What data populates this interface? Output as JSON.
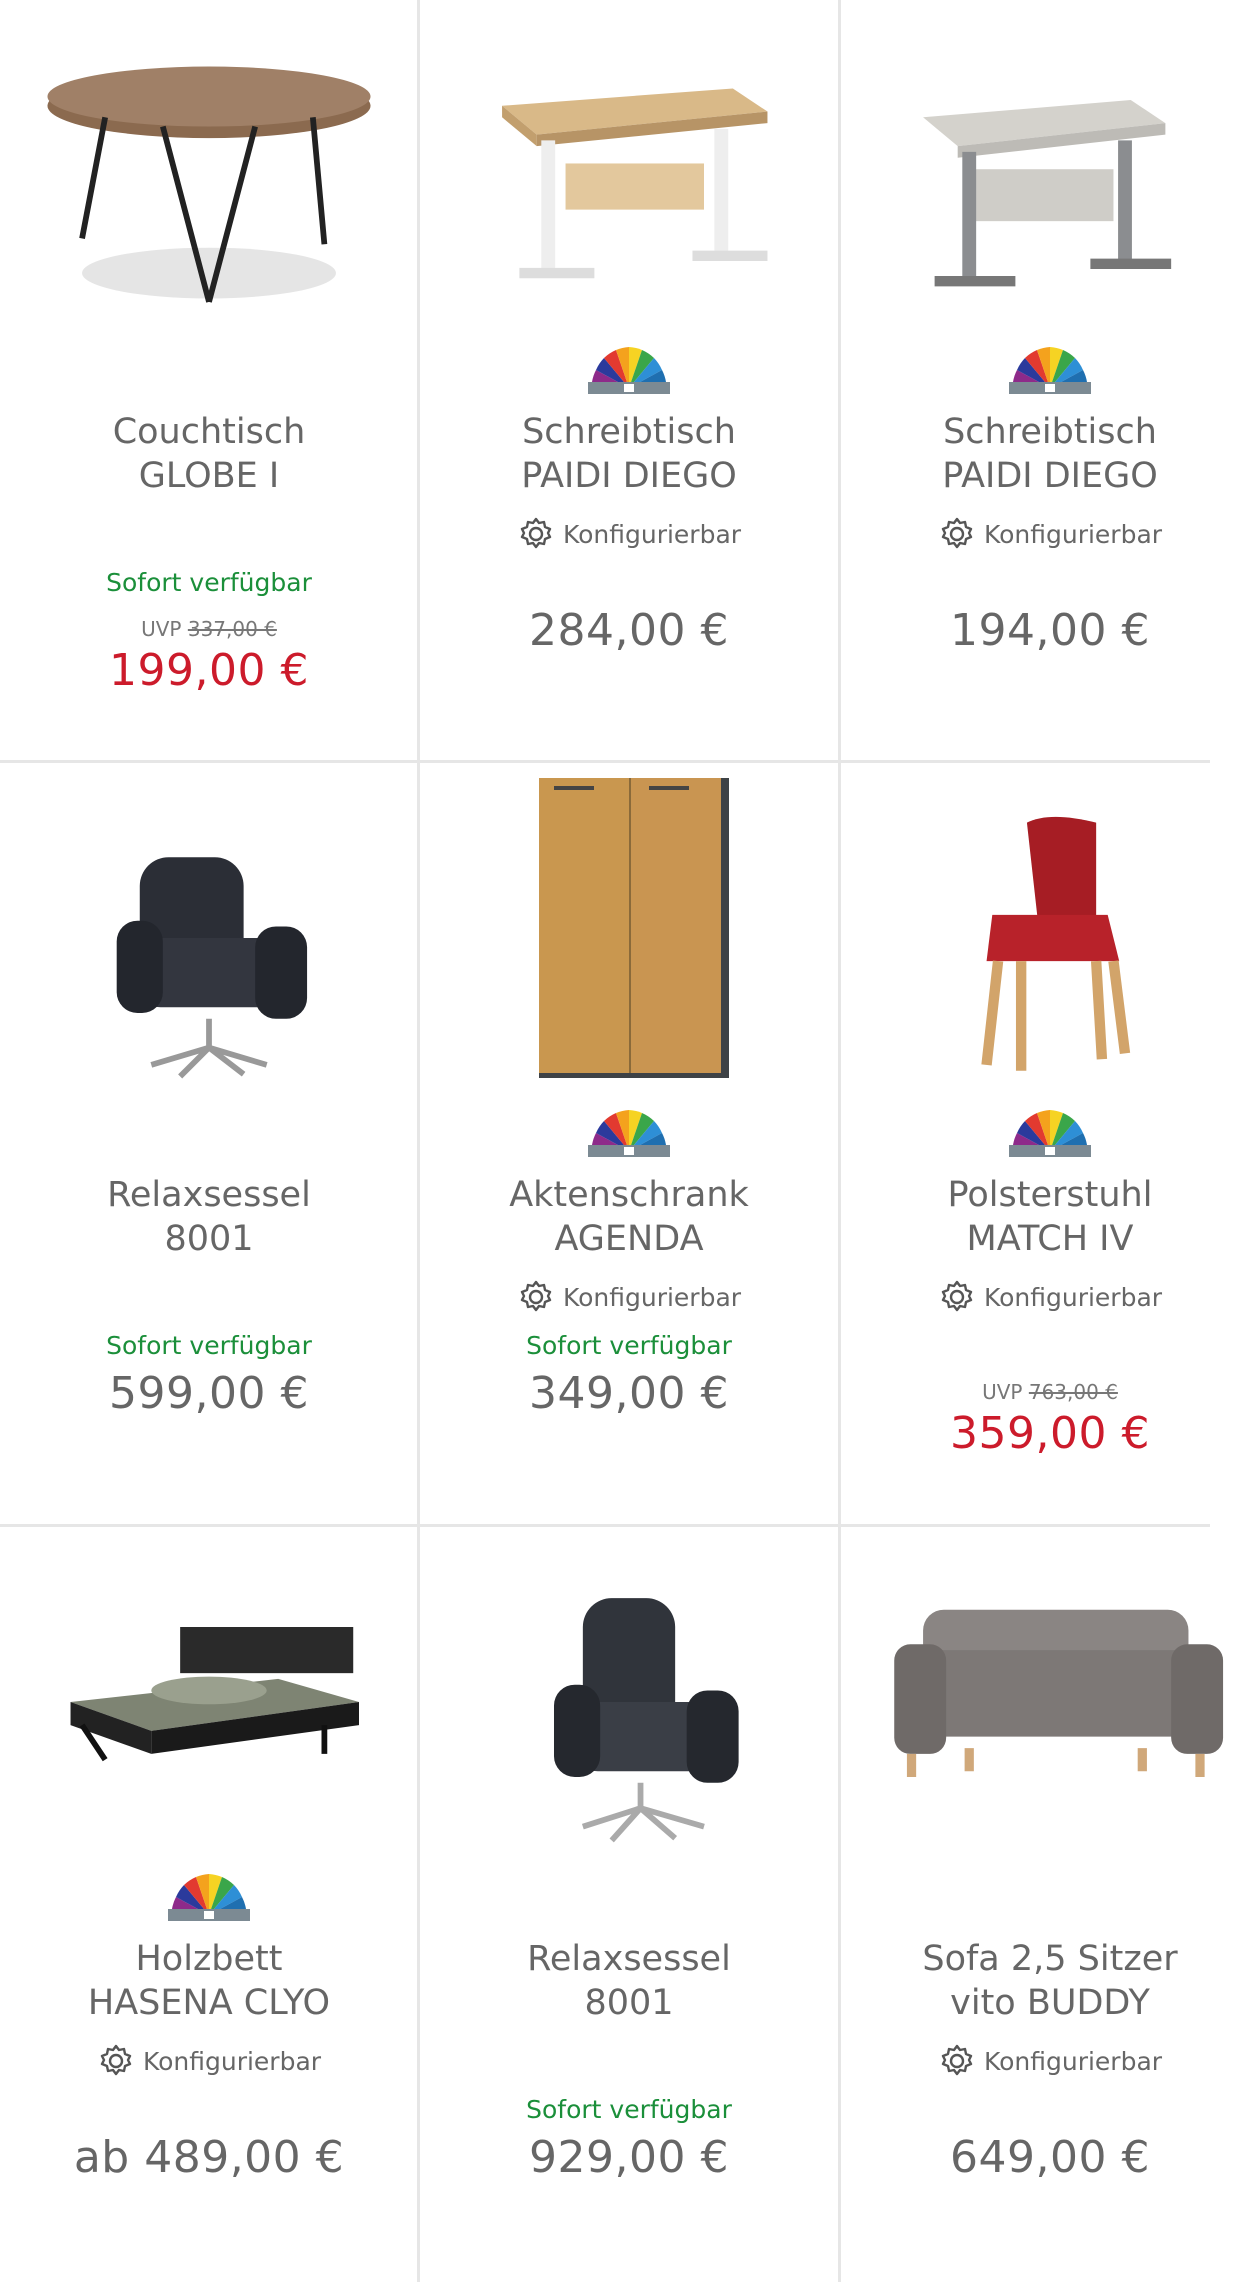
{
  "products": [
    {
      "title_line1": "Couchtisch",
      "title_line2": "GLOBE I",
      "configurable": false,
      "config_label": "",
      "availability": "Sofort verfügbar",
      "uvp_label": "UVP",
      "uvp_price": "337,00 €",
      "price": "199,00 €",
      "sale": true,
      "colors_badge": false,
      "image": "round-coffee-table"
    },
    {
      "title_line1": "Schreibtisch",
      "title_line2": "PAIDI DIEGO",
      "configurable": true,
      "config_label": "Konfigurierbar",
      "availability": "",
      "uvp_label": "",
      "uvp_price": "",
      "price": "284,00 €",
      "sale": false,
      "colors_badge": true,
      "image": "oak-desk"
    },
    {
      "title_line1": "Schreibtisch",
      "title_line2": "PAIDI DIEGO",
      "configurable": true,
      "config_label": "Konfigurierbar",
      "availability": "",
      "uvp_label": "",
      "uvp_price": "",
      "price": "194,00 €",
      "sale": false,
      "colors_badge": true,
      "image": "grey-desk"
    },
    {
      "title_line1": "Relaxsessel",
      "title_line2": "8001",
      "configurable": false,
      "config_label": "",
      "availability": "Sofort verfügbar",
      "uvp_label": "",
      "uvp_price": "",
      "price": "599,00 €",
      "sale": false,
      "colors_badge": false,
      "image": "recliner-fabric"
    },
    {
      "title_line1": "Aktenschrank",
      "title_line2": "AGENDA",
      "configurable": true,
      "config_label": "Konfigurierbar",
      "availability": "Sofort verfügbar",
      "uvp_label": "",
      "uvp_price": "",
      "price": "349,00 €",
      "sale": false,
      "colors_badge": true,
      "image": "file-cabinet"
    },
    {
      "title_line1": "Polsterstuhl",
      "title_line2": "MATCH IV",
      "configurable": true,
      "config_label": "Konfigurierbar",
      "availability": "",
      "uvp_label": "UVP",
      "uvp_price": "763,00 €",
      "price": "359,00 €",
      "sale": true,
      "colors_badge": true,
      "image": "red-chair"
    },
    {
      "title_line1": "Holzbett",
      "title_line2": "HASENA CLYO",
      "configurable": true,
      "config_label": "Konfigurierbar",
      "availability": "",
      "uvp_label": "",
      "uvp_price": "",
      "price": "ab 489,00 €",
      "sale": false,
      "colors_badge": true,
      "image": "wood-bed"
    },
    {
      "title_line1": "Relaxsessel",
      "title_line2": "8001",
      "configurable": false,
      "config_label": "",
      "availability": "Sofort verfügbar",
      "uvp_label": "",
      "uvp_price": "",
      "price": "929,00 €",
      "sale": false,
      "colors_badge": false,
      "image": "recliner-leather"
    },
    {
      "title_line1": "Sofa 2,5 Sitzer",
      "title_line2": "vito BUDDY",
      "configurable": true,
      "config_label": "Konfigurierbar",
      "availability": "",
      "uvp_label": "",
      "uvp_price": "",
      "price": "649,00 €",
      "sale": false,
      "colors_badge": false,
      "image": "grey-sofa"
    }
  ],
  "colors": {
    "available": "#1b8f3a",
    "sale_price": "#cc1b2b",
    "text": "#666666",
    "divider": "#e6e6e6"
  }
}
